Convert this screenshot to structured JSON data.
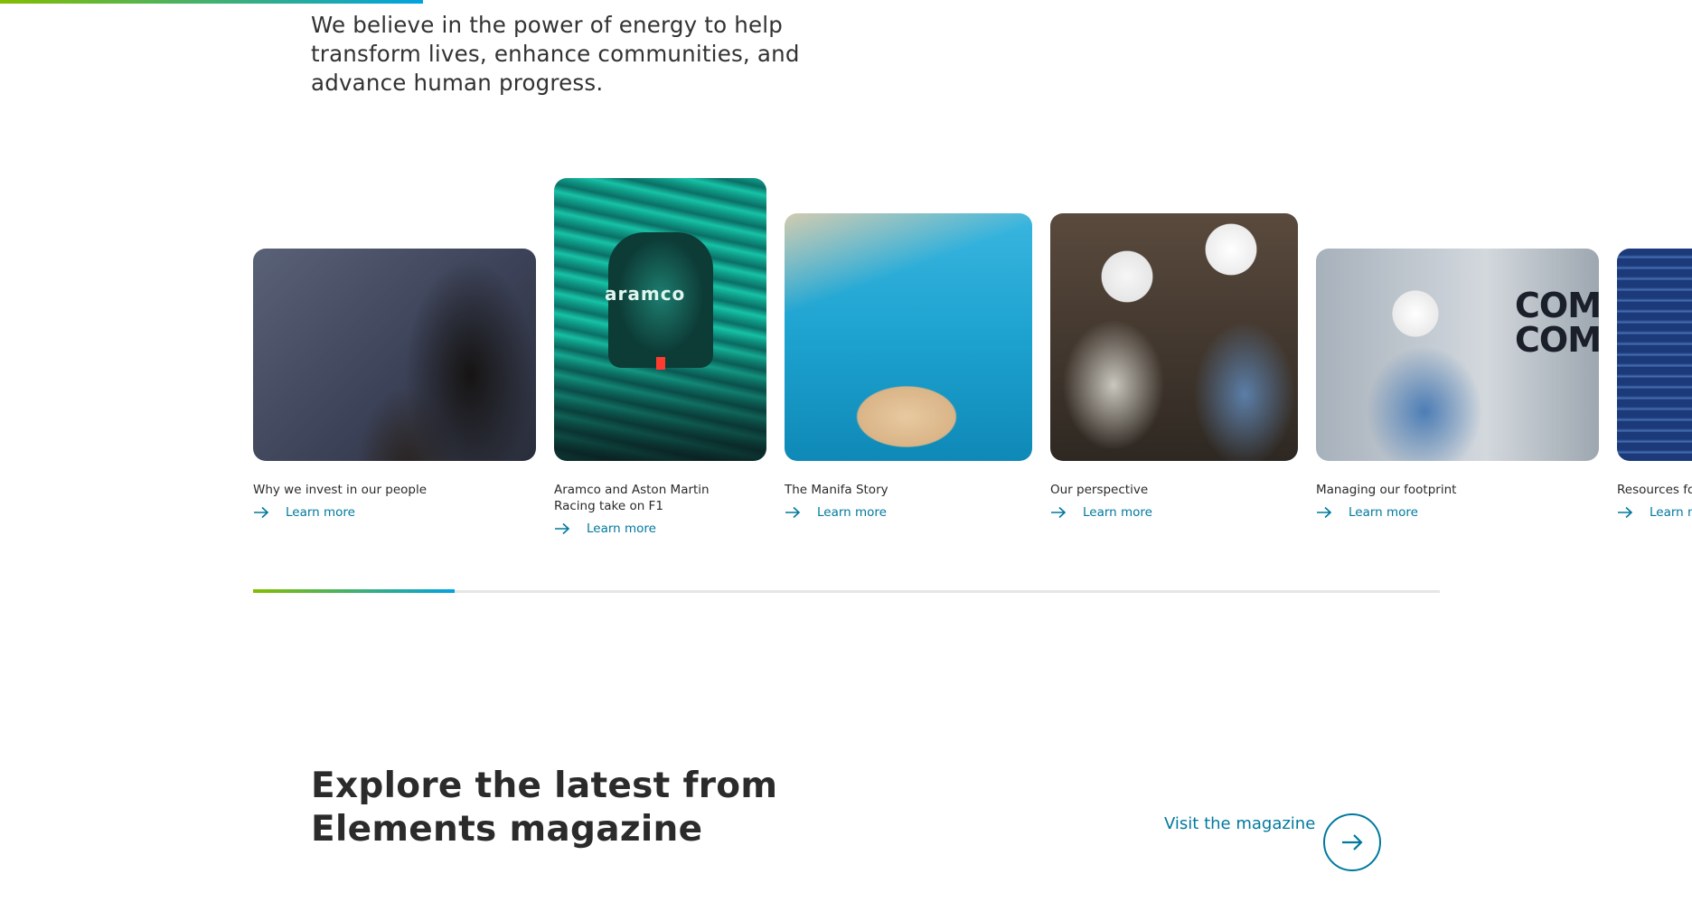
{
  "intro": {
    "text": "We believe in the power of energy to help transform lives, enhance communities, and advance human progress."
  },
  "cards": [
    {
      "title": "Why we invest in our people",
      "cta": "Learn more"
    },
    {
      "title": "Aramco and Aston Martin Racing take on F1",
      "cta": "Learn more",
      "image_text": "aramco"
    },
    {
      "title": "The Manifa Story",
      "cta": "Learn more"
    },
    {
      "title": "Our perspective",
      "cta": "Learn more"
    },
    {
      "title": "Managing our footprint",
      "cta": "Learn more",
      "image_text": "COMP\nCOMP"
    },
    {
      "title": "Resources fo",
      "cta": "Learn m"
    }
  ],
  "carousel": {
    "progress": 0.17
  },
  "magazine": {
    "heading": "Explore the latest from Elements magazine",
    "link_label": "Visit the magazine"
  },
  "colors": {
    "accent_blue": "#00799e",
    "gradient_start": "#84bd00",
    "gradient_end": "#00a3e0"
  },
  "icons": {
    "arrow": "arrow-right-icon"
  }
}
